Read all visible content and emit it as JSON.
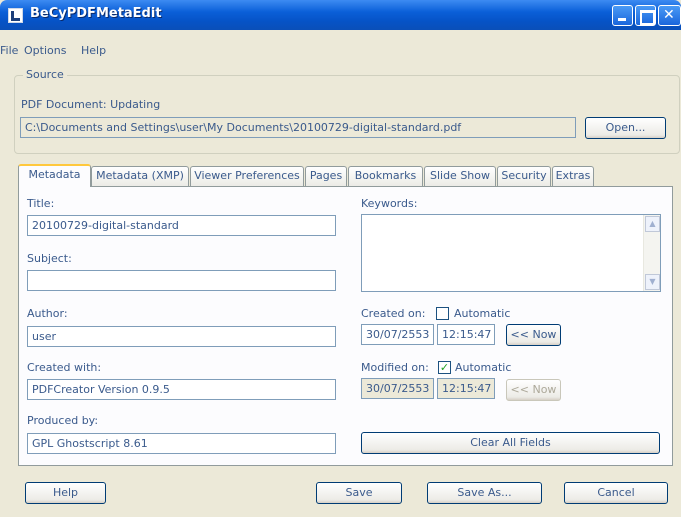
{
  "window": {
    "title": "BeCyPDFMetaEdit"
  },
  "menu": {
    "file": "File",
    "options": "Options",
    "help": "Help"
  },
  "source": {
    "group_title": "Source",
    "doc_label": "PDF Document:  Updating",
    "path": "C:\\Documents and Settings\\user\\My Documents\\20100729-digital-standard.pdf",
    "open_label": "Open..."
  },
  "tabs": [
    "Metadata",
    "Metadata (XMP)",
    "Viewer Preferences",
    "Pages",
    "Bookmarks",
    "Slide Show",
    "Security",
    "Extras"
  ],
  "metadata": {
    "title_label": "Title:",
    "title_value": "20100729-digital-standard",
    "subject_label": "Subject:",
    "subject_value": "",
    "author_label": "Author:",
    "author_value": "user",
    "created_with_label": "Created with:",
    "created_with_value": "PDFCreator Version 0.9.5",
    "produced_by_label": "Produced by:",
    "produced_by_value": "GPL Ghostscript 8.61",
    "keywords_label": "Keywords:",
    "keywords_value": "",
    "created_on_label": "Created on:",
    "created_auto_label": "Automatic",
    "created_auto_checked": false,
    "created_date": "30/07/2553",
    "created_time": "12:15:47",
    "created_now_label": "<< Now",
    "modified_on_label": "Modified on:",
    "modified_auto_label": "Automatic",
    "modified_auto_checked": true,
    "modified_date": "30/07/2553",
    "modified_time": "12:15:47",
    "modified_now_label": "<< Now",
    "clear_label": "Clear All Fields"
  },
  "footer": {
    "help": "Help",
    "save": "Save",
    "save_as": "Save As...",
    "cancel": "Cancel"
  }
}
